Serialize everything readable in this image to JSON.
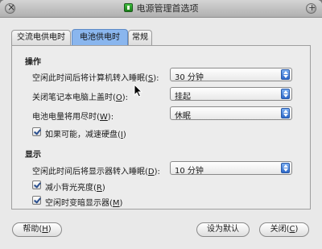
{
  "window": {
    "title": "电源管理首选项"
  },
  "tabs": [
    {
      "label": "交流电供电时"
    },
    {
      "label": "电池供电时"
    },
    {
      "label": "常规"
    }
  ],
  "actions": {
    "heading": "操作",
    "sleep_label": "空闲此时间后将计算机转入睡眠(",
    "sleep_key": "S",
    "sleep_suffix": "):",
    "sleep_value": "30 分钟",
    "lid_label": "关闭笔记本电脑上盖时(",
    "lid_key": "O",
    "lid_suffix": "):",
    "lid_value": "挂起",
    "battery_label": "电池电量将用尽时(",
    "battery_key": "W",
    "battery_suffix": "):",
    "battery_value": "休眠",
    "spindown_label": "如果可能，减速硬盘(",
    "spindown_key": "I",
    "spindown_suffix": ")"
  },
  "display": {
    "heading": "显示",
    "sleep_label": "空闲此时间后将显示器转入睡眠(",
    "sleep_key": "D",
    "sleep_suffix": "):",
    "sleep_value": "10 分钟",
    "reduce_label": "减小背光亮度(",
    "reduce_key": "R",
    "reduce_suffix": ")",
    "dim_label": "空闲时变暗显示器(",
    "dim_key": "M",
    "dim_suffix": ")"
  },
  "buttons": {
    "help": "帮助(",
    "help_key": "H",
    "help_suffix": ")",
    "default": "设为默认",
    "close": "关闭(",
    "close_key": "C",
    "close_suffix": ")"
  }
}
